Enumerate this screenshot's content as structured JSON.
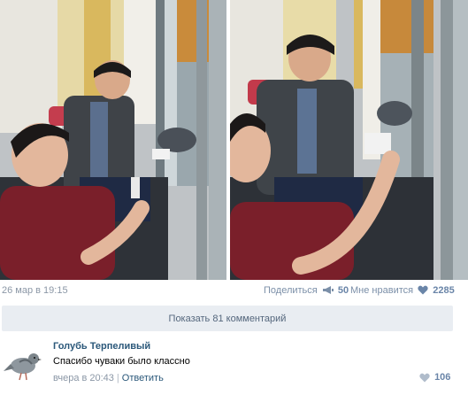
{
  "post": {
    "date": "26 мар в 19:15",
    "share_label": "Поделиться",
    "share_count": "50",
    "like_label": "Мне нравится",
    "like_count": "2285",
    "show_comments": "Показать 81 комментарий"
  },
  "comment": {
    "author": "Голубь Терпеливый",
    "text": "Спасибо чуваки было классно",
    "time": "вчера в 20:43",
    "reply_label": "Ответить",
    "like_count": "106"
  },
  "icons": {
    "share": "megaphone-icon",
    "like": "heart-icon",
    "avatar": "pigeon-icon"
  },
  "colors": {
    "link": "#2b587a",
    "meta": "#8b97a6",
    "button_bg": "#e9edf2"
  }
}
